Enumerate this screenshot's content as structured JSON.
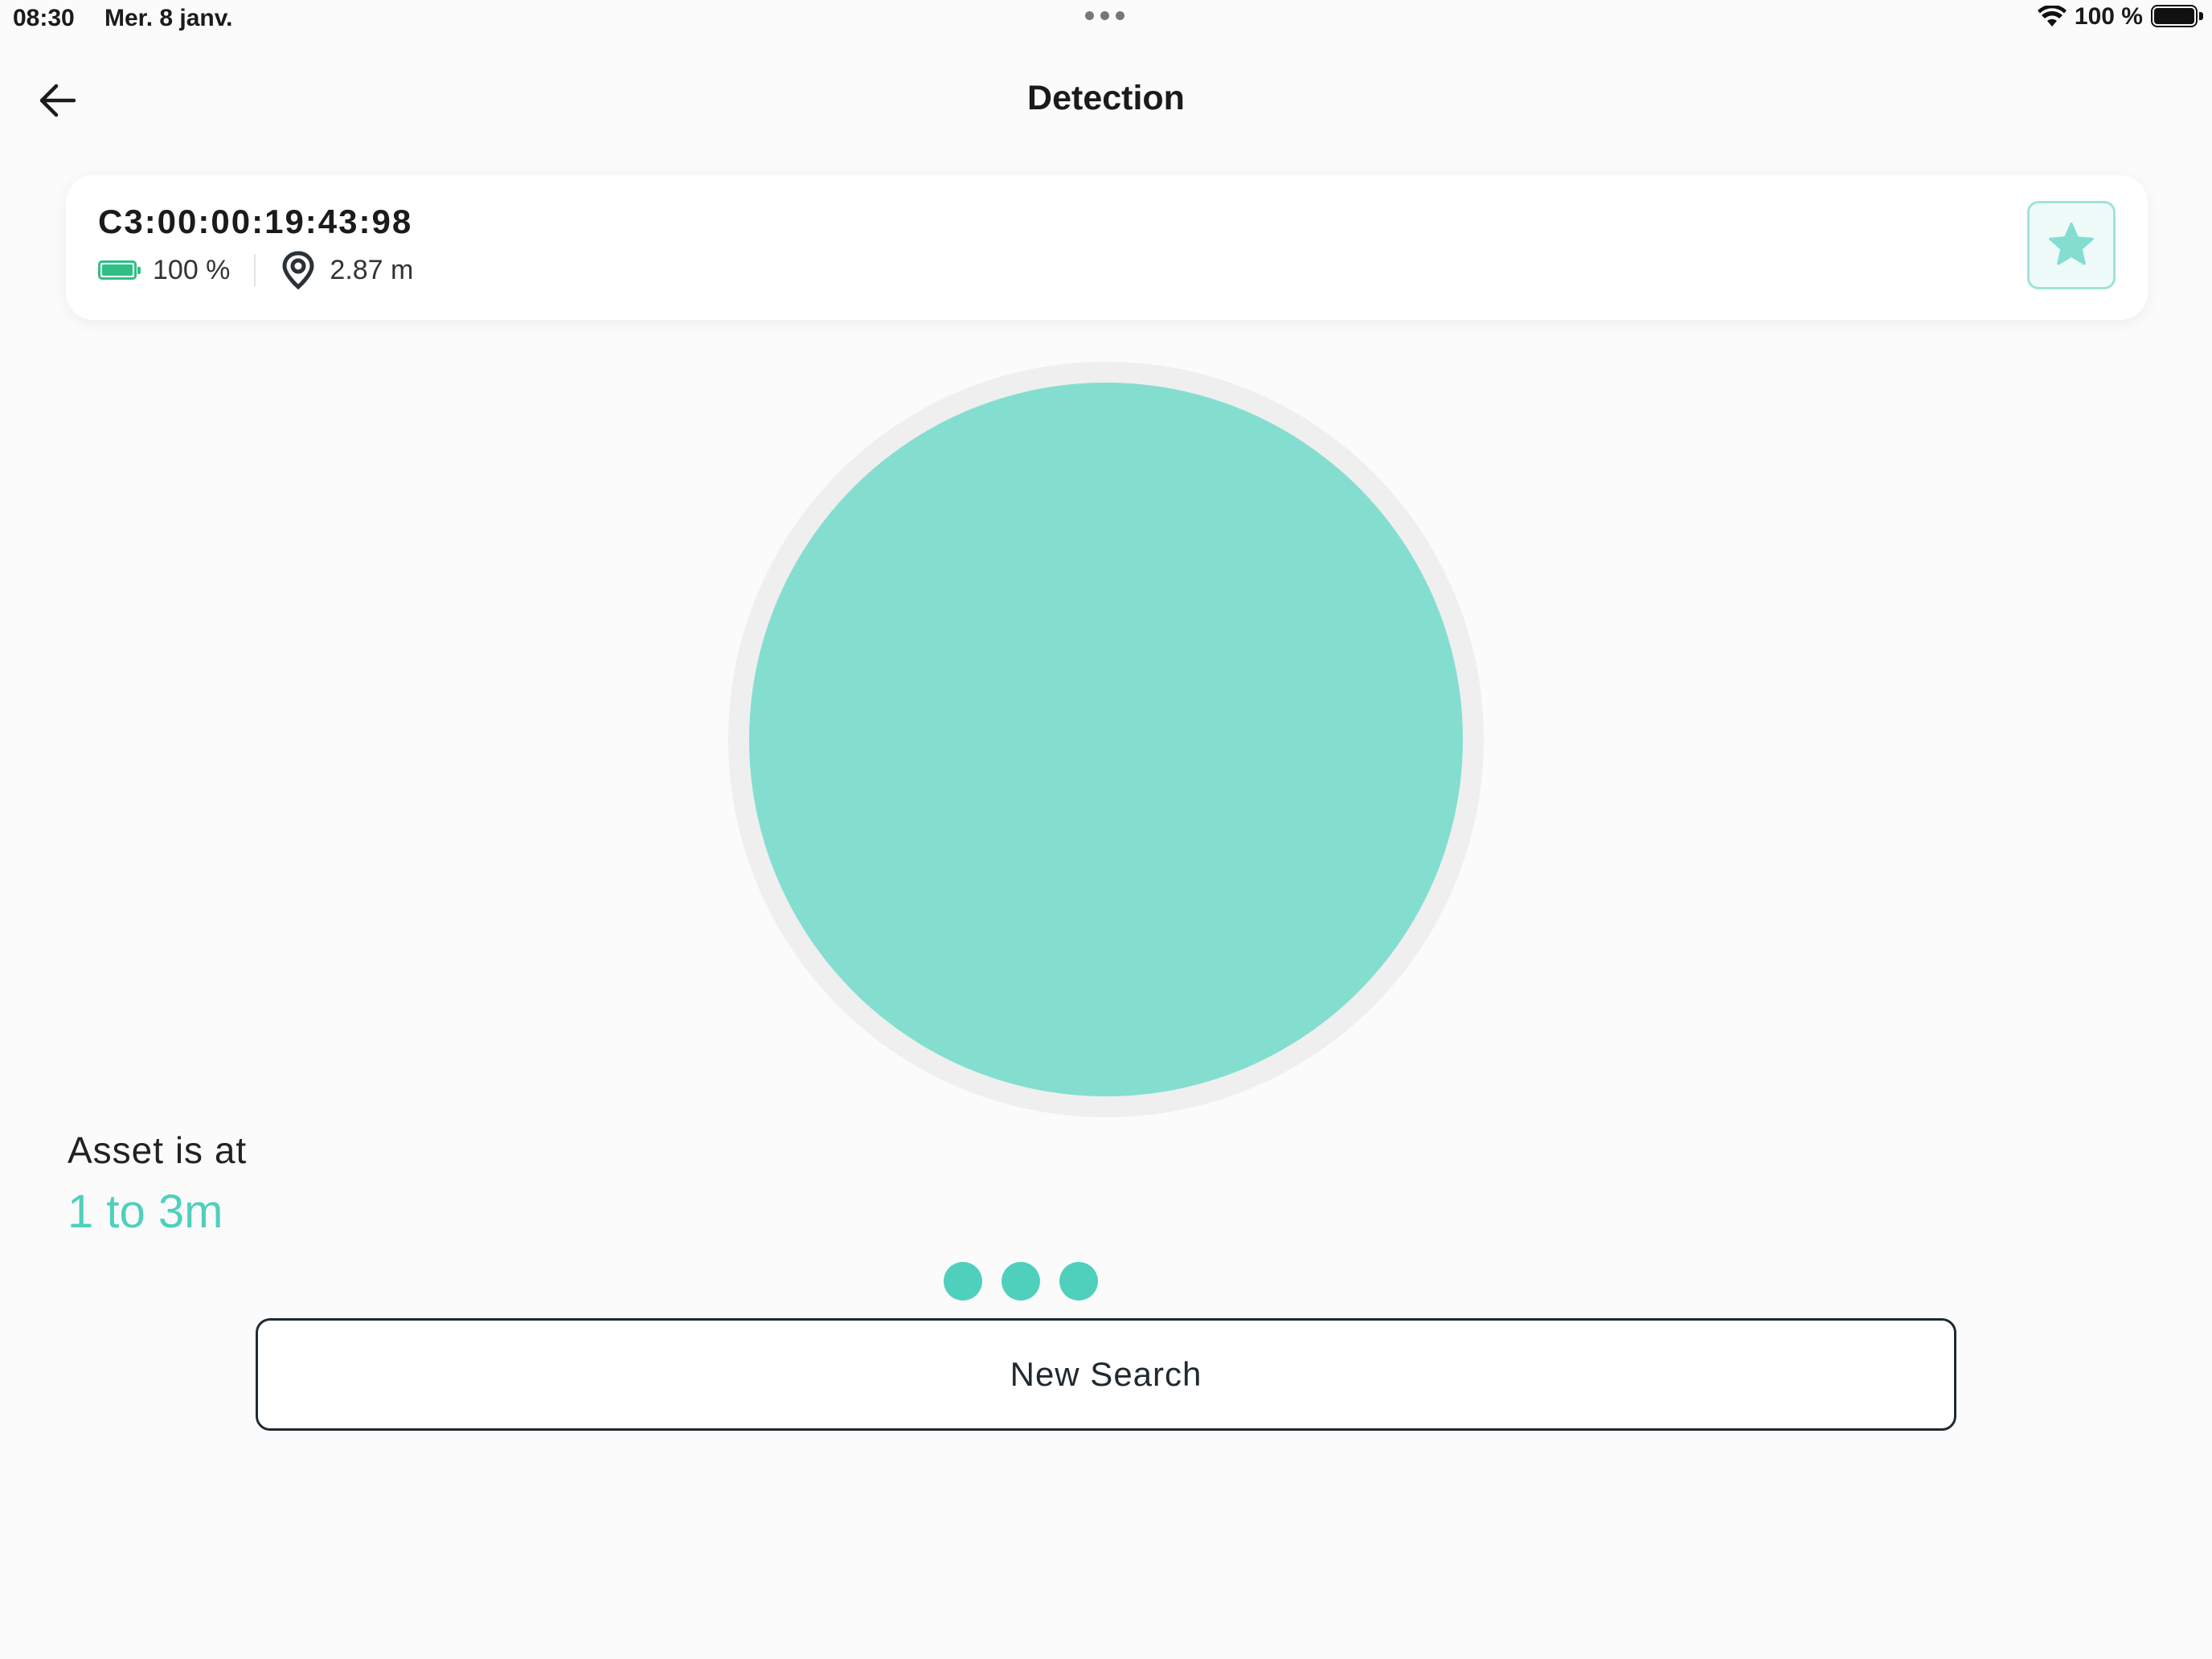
{
  "status_bar": {
    "time": "08:30",
    "date": "Mer. 8 janv.",
    "battery_text": "100 %",
    "icons": [
      "multitasking-dots-icon",
      "wifi-icon",
      "battery-icon"
    ]
  },
  "header": {
    "title": "Detection",
    "back_icon": "arrow-left-icon"
  },
  "device_card": {
    "device_id": "C3:00:00:19:43:98",
    "battery": "100 %",
    "battery_color": "#2fbf86",
    "distance": "2.87 m",
    "icons": [
      "battery-icon",
      "location-pin-icon",
      "star-icon"
    ],
    "favorite_color": "#83ded0"
  },
  "proximity": {
    "circle_color": "#83ded0",
    "ring_color": "#efefef"
  },
  "asset": {
    "label": "Asset is at",
    "range": "1 to 3m",
    "range_color": "#4fd0bd"
  },
  "actions": {
    "new_search_label": "New Search"
  }
}
